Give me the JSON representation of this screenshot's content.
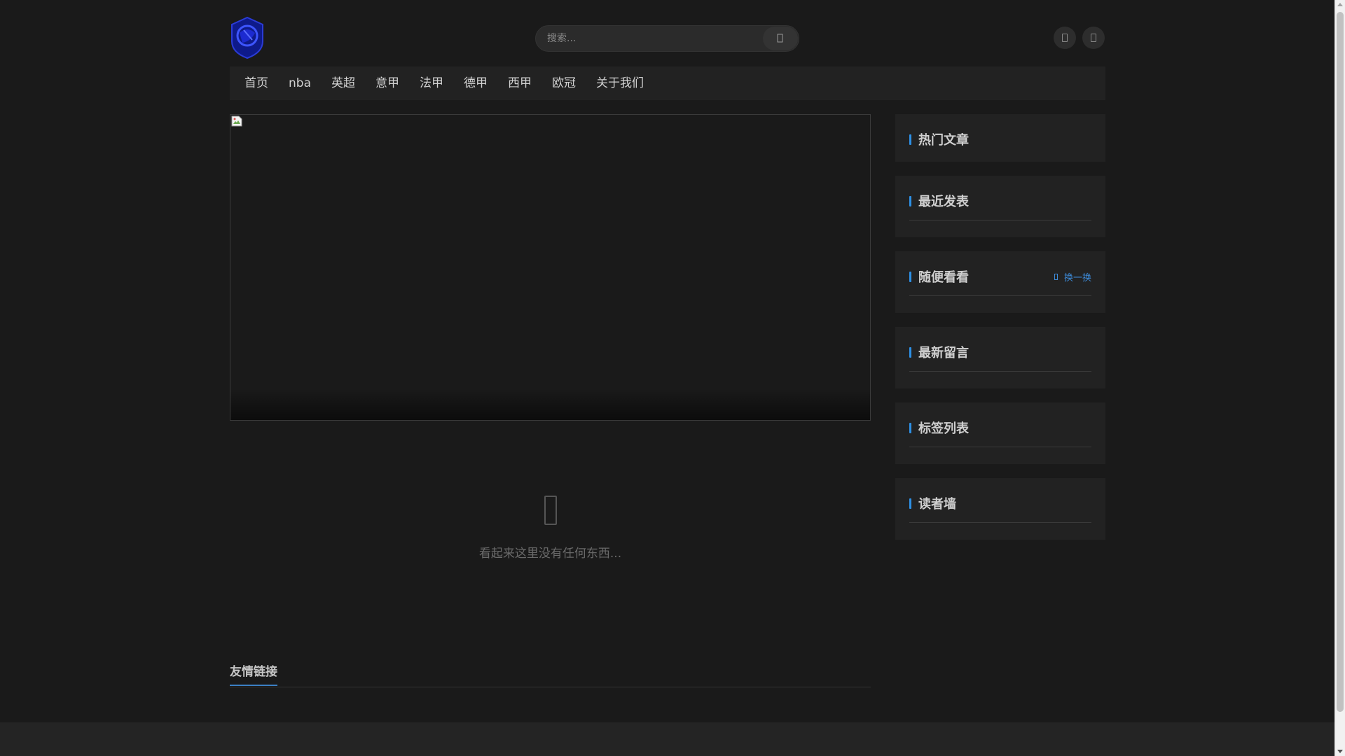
{
  "header": {
    "search_placeholder": "搜索...",
    "search_icon": "search-icon",
    "buttons": [
      "theme-toggle-icon",
      "user-icon"
    ]
  },
  "nav": {
    "items": [
      "首页",
      "nba",
      "英超",
      "意甲",
      "法甲",
      "德甲",
      "西甲",
      "欧冠",
      "关于我们"
    ]
  },
  "main": {
    "empty_text": "看起来这里没有任何东西...",
    "links_title": "友情链接"
  },
  "sidebar": {
    "hot_articles": "热门文章",
    "recent_posts": "最近发表",
    "random_look": "随便看看",
    "refresh_label": "换一换",
    "latest_comments": "最新留言",
    "tag_list": "标签列表",
    "readers_wall": "读者墙"
  },
  "colors": {
    "accent": "#2e90e6",
    "background": "#1a1a1a",
    "panel": "#222222"
  }
}
